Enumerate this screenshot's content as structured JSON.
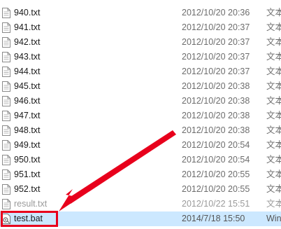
{
  "files": [
    {
      "name": "940.txt",
      "modified": "2012/10/20 20:36",
      "type": "文本",
      "icon": "text-file-icon"
    },
    {
      "name": "941.txt",
      "modified": "2012/10/20 20:37",
      "type": "文本",
      "icon": "text-file-icon"
    },
    {
      "name": "942.txt",
      "modified": "2012/10/20 20:37",
      "type": "文本",
      "icon": "text-file-icon"
    },
    {
      "name": "943.txt",
      "modified": "2012/10/20 20:37",
      "type": "文本",
      "icon": "text-file-icon"
    },
    {
      "name": "944.txt",
      "modified": "2012/10/20 20:37",
      "type": "文本",
      "icon": "text-file-icon"
    },
    {
      "name": "945.txt",
      "modified": "2012/10/20 20:38",
      "type": "文本",
      "icon": "text-file-icon"
    },
    {
      "name": "946.txt",
      "modified": "2012/10/20 20:38",
      "type": "文本",
      "icon": "text-file-icon"
    },
    {
      "name": "947.txt",
      "modified": "2012/10/20 20:38",
      "type": "文本",
      "icon": "text-file-icon"
    },
    {
      "name": "948.txt",
      "modified": "2012/10/20 20:38",
      "type": "文本",
      "icon": "text-file-icon"
    },
    {
      "name": "949.txt",
      "modified": "2012/10/20 20:54",
      "type": "文本",
      "icon": "text-file-icon"
    },
    {
      "name": "950.txt",
      "modified": "2012/10/20 20:54",
      "type": "文本",
      "icon": "text-file-icon"
    },
    {
      "name": "951.txt",
      "modified": "2012/10/20 20:55",
      "type": "文本",
      "icon": "text-file-icon"
    },
    {
      "name": "952.txt",
      "modified": "2012/10/20 20:55",
      "type": "文本",
      "icon": "text-file-icon"
    },
    {
      "name": "result.txt",
      "modified": "2012/10/22 15:51",
      "type": "文本",
      "icon": "text-file-icon"
    },
    {
      "name": "test.bat",
      "modified": "2014/7/18 15:50",
      "type": "Win",
      "icon": "batch-file-icon",
      "selected": true
    }
  ],
  "annotation": {
    "highlighted_file": "test.bat",
    "color": "#e8001c"
  },
  "colors": {
    "selection": "#cce8ff",
    "secondary_text": "#6d6d6d"
  }
}
